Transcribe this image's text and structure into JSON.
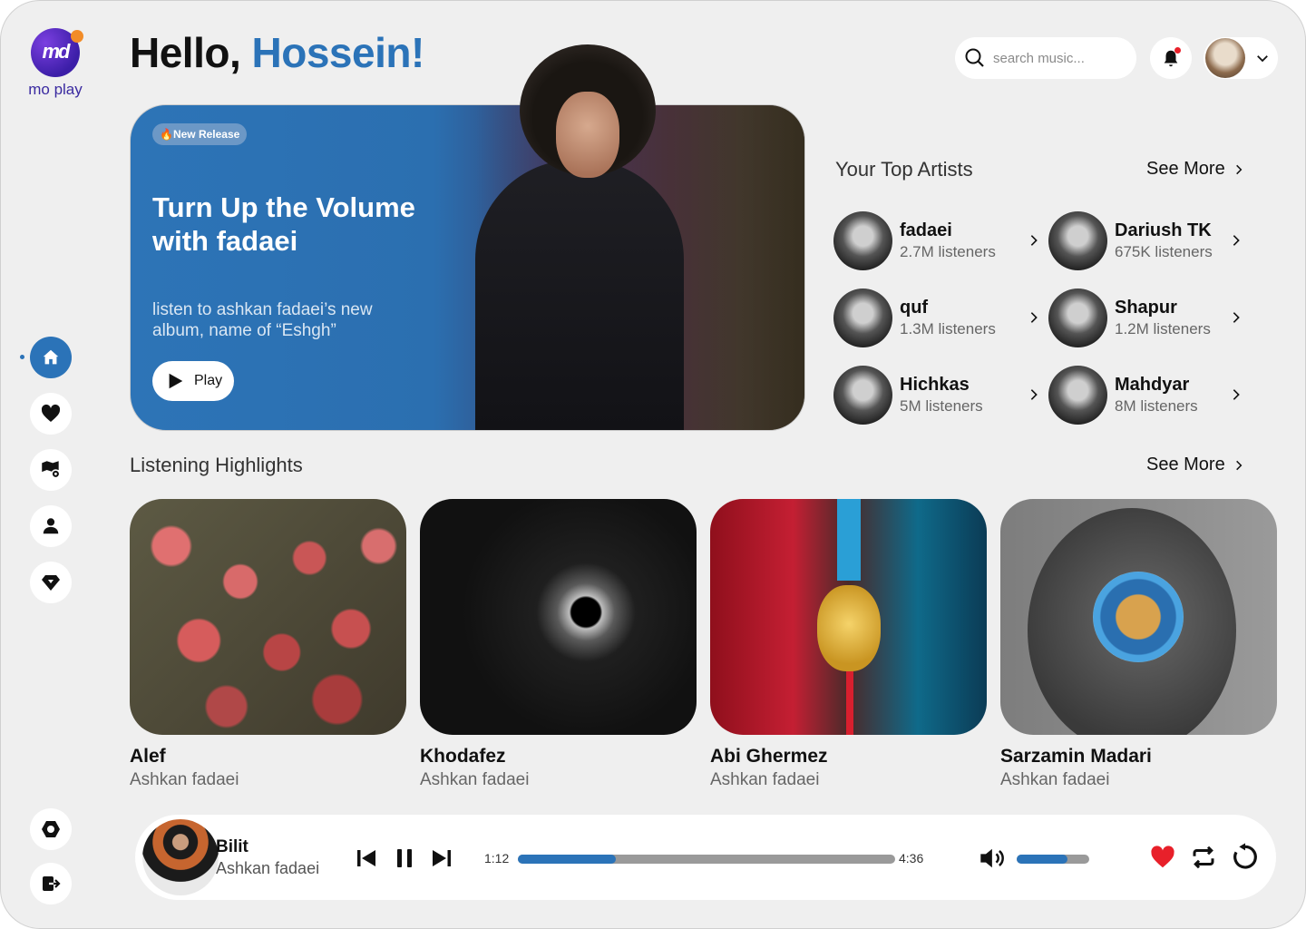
{
  "app": {
    "logo_text": "mo play",
    "logo_mark": "md"
  },
  "sidebar": {
    "items": [
      {
        "name": "home",
        "icon": "home-icon",
        "active": true
      },
      {
        "name": "favorites",
        "icon": "heart-icon",
        "active": false
      },
      {
        "name": "explore",
        "icon": "map-pin-icon",
        "active": false
      },
      {
        "name": "profile",
        "icon": "user-icon",
        "active": false
      },
      {
        "name": "premium",
        "icon": "diamond-icon",
        "active": false
      }
    ],
    "bottom": [
      {
        "name": "settings",
        "icon": "settings-icon"
      },
      {
        "name": "logout",
        "icon": "logout-icon"
      }
    ]
  },
  "header": {
    "greeting": "Hello,",
    "user_name": "Hossein!",
    "search_placeholder": "search music...",
    "has_notification": true
  },
  "hero": {
    "badge": "🔥New Release",
    "title": "Turn Up the Volume with fadaei",
    "subtitle": "listen to ashkan fadaei’s new album, name of “Eshgh”",
    "play_label": "Play"
  },
  "top_artists": {
    "title": "Your Top Artists",
    "see_more": "See More",
    "items": [
      {
        "name": "fadaei",
        "listeners": "2.7M listeners"
      },
      {
        "name": "Dariush TK",
        "listeners": "675K listeners"
      },
      {
        "name": "quf",
        "listeners": "1.3M listeners"
      },
      {
        "name": "Shapur",
        "listeners": "1.2M listeners"
      },
      {
        "name": "Hichkas",
        "listeners": "5M listeners"
      },
      {
        "name": "Mahdyar",
        "listeners": "8M listeners"
      }
    ]
  },
  "highlights": {
    "title": "Listening Highlights",
    "see_more": "See More",
    "items": [
      {
        "title": "Alef",
        "artist": "Ashkan fadaei"
      },
      {
        "title": "Khodafez",
        "artist": "Ashkan fadaei"
      },
      {
        "title": "Abi Ghermez",
        "artist": "Ashkan fadaei"
      },
      {
        "title": "Sarzamin Madari",
        "artist": "Ashkan fadaei"
      }
    ]
  },
  "player": {
    "song": "Bilit",
    "artist": "Ashkan fadaei",
    "elapsed": "1:12",
    "duration": "4:36",
    "progress_fraction": 0.26,
    "volume_fraction": 0.7,
    "liked": true
  },
  "colors": {
    "accent": "#2b73b8",
    "background": "#efefef",
    "like": "#e8202a"
  }
}
